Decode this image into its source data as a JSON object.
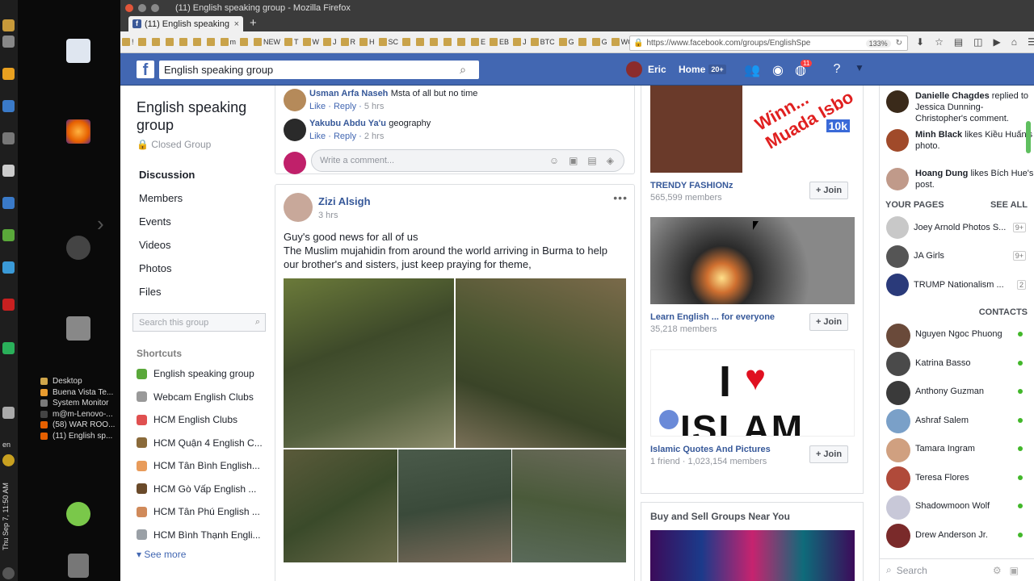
{
  "window": {
    "title": "(11) English speaking group - Mozilla Firefox"
  },
  "tab": {
    "label": "(11) English speaking",
    "close": "×",
    "new": "+"
  },
  "bookmarks": [
    "!",
    "",
    "",
    "",
    "",
    "",
    "",
    "m",
    "",
    "NEW",
    "T",
    "W",
    "J",
    "R",
    "H",
    "SC",
    "",
    "",
    "",
    "",
    "",
    "E",
    "EB",
    "J",
    "BTC",
    "G",
    "",
    "G",
    "WOW"
  ],
  "url": {
    "text": "https://www.facebook.com/groups/EnglishSpe",
    "zoom": "133%"
  },
  "os": {
    "clock": "Thu Sep 7, 11:50 AM",
    "lang": "en"
  },
  "tasks": [
    {
      "label": "Desktop",
      "color": "#cfa54a"
    },
    {
      "label": "Buena Vista Te...",
      "color": "#e89b2f"
    },
    {
      "label": "System Monitor",
      "color": "#7a7a7a"
    },
    {
      "label": "m@m-Lenovo-...",
      "color": "#444444"
    },
    {
      "label": "(58) WAR ROO...",
      "color": "#e66000"
    },
    {
      "label": "(11) English sp...",
      "color": "#e66000"
    }
  ],
  "fb": {
    "search_value": "English speaking group",
    "user": "Eric",
    "home": "Home",
    "home_count": "20+",
    "notif_count": "11"
  },
  "group": {
    "name": "English speaking group",
    "privacy": "Closed Group",
    "nav": [
      "Discussion",
      "Members",
      "Events",
      "Videos",
      "Photos",
      "Files"
    ],
    "search_placeholder": "Search this group",
    "shortcuts_title": "Shortcuts",
    "shortcuts": [
      {
        "label": "English speaking group",
        "color": "#5aa83a"
      },
      {
        "label": "Webcam English Clubs",
        "color": "#999999"
      },
      {
        "label": "HCM English Clubs",
        "color": "#e05050"
      },
      {
        "label": "HCM Quận 4 English C...",
        "color": "#8a6a3a"
      },
      {
        "label": "HCM Tân Bình English...",
        "color": "#e89b5a"
      },
      {
        "label": "HCM Gò Vấp English ...",
        "color": "#6a4a2a"
      },
      {
        "label": "HCM Tân Phú English ...",
        "color": "#d08a5a"
      },
      {
        "label": "HCM Bình Thạnh Engli...",
        "color": "#9aa0a6"
      }
    ],
    "see_more": "See more"
  },
  "comments": [
    {
      "name": "Usman Arfa Naseh",
      "text": "Msta of all but no time",
      "like": "Like",
      "reply": "Reply",
      "time": "5 hrs",
      "color": "#b58a5a"
    },
    {
      "name": "Yakubu Abdu Ya'u",
      "text": "geography",
      "like": "Like",
      "reply": "Reply",
      "time": "2 hrs",
      "color": "#2a2a2a"
    }
  ],
  "write_comment": "Write a comment...",
  "post": {
    "author": "Zizi Alsigh",
    "time": "3 hrs",
    "more": "•••",
    "line1": "Guy's good news for all of us",
    "line2": "The Muslim mujahidin from around the world arriving in Burma to help our brother's and sisters, just keep praying for theme,"
  },
  "suggestions": [
    {
      "name": "TRENDY FASHIONz",
      "meta": "565,599 members",
      "join": "+ Join",
      "overlay": "Winn... Muada Isbo",
      "badge": "10k"
    },
    {
      "name": "Learn English ... for everyone",
      "meta": "35,218 members",
      "join": "+ Join"
    },
    {
      "name": "Islamic Quotes And Pictures",
      "meta": "1 friend · 1,023,154 members",
      "join": "+ Join",
      "banner_i": "I",
      "banner_word": "ISLAM"
    }
  ],
  "buysell_title": "Buy and Sell Groups Near You",
  "activity": [
    {
      "name": "Danielle Chagdes",
      "text": "replied to Jessica Dunning-Christopher's comment.",
      "color": "#3a2a1a"
    },
    {
      "name": "Minh Black",
      "text": "likes Kiều Huấn's photo.",
      "color": "#a04a2a"
    },
    {
      "name": "Hoang Dung",
      "text": "likes Bích Hue's post.",
      "color": "#c09a8a"
    }
  ],
  "your_pages": {
    "title": "YOUR PAGES",
    "see_all": "SEE ALL",
    "items": [
      {
        "name": "Joey Arnold Photos S...",
        "badge": "9+",
        "color": "#c8c8c8"
      },
      {
        "name": "JA Girls",
        "badge": "9+",
        "color": "#555555"
      },
      {
        "name": "TRUMP Nationalism ...",
        "badge": "2",
        "color": "#2a3a7a"
      }
    ]
  },
  "contacts": {
    "title": "CONTACTS",
    "items": [
      {
        "name": "Nguyen Ngoc Phuong",
        "color": "#6a4a3a"
      },
      {
        "name": "Katrina Basso",
        "color": "#4a4a4a"
      },
      {
        "name": "Anthony Guzman",
        "color": "#3a3a3a"
      },
      {
        "name": "Ashraf Salem",
        "color": "#7aa0c8"
      },
      {
        "name": "Tamara Ingram",
        "color": "#d0a080"
      },
      {
        "name": "Teresa Flores",
        "color": "#b04a3a"
      },
      {
        "name": "Shadowmoon Wolf",
        "color": "#c8c8d8"
      },
      {
        "name": "Drew Anderson Jr.",
        "color": "#7a2a2a"
      }
    ]
  },
  "chat_search": "Search"
}
